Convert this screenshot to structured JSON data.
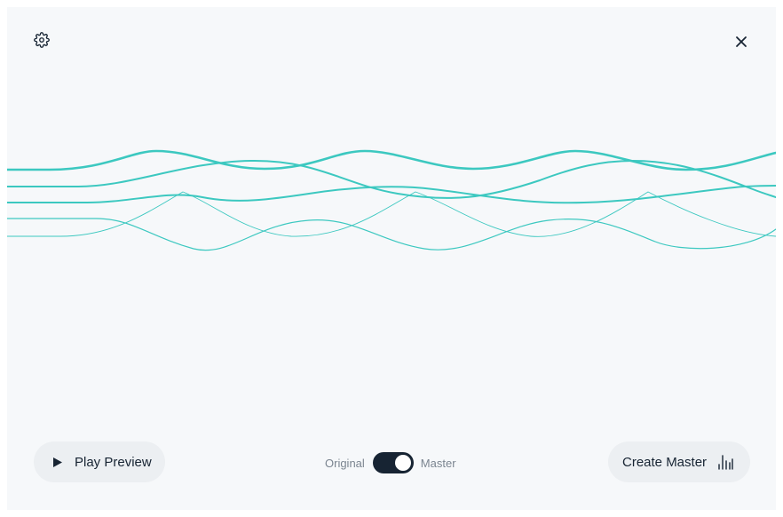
{
  "header": {
    "settings_icon": "gear-icon",
    "close_icon": "close-icon"
  },
  "visualizer": {
    "accent_color": "#3cc8c0",
    "waveform": "multi-line-wave"
  },
  "footer": {
    "play_label": "Play Preview",
    "play_icon": "play-icon",
    "toggle": {
      "left_label": "Original",
      "right_label": "Master",
      "state": "Master",
      "track_color": "#172433"
    },
    "create_label": "Create Master",
    "create_icon": "equalizer-bars-icon"
  }
}
